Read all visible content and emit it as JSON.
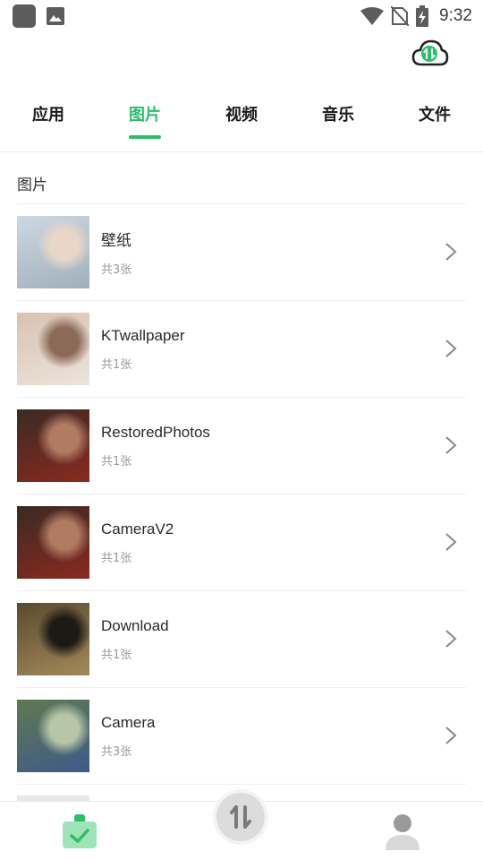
{
  "status_bar": {
    "time": "9:32"
  },
  "tabs": [
    {
      "label": "应用",
      "active": false
    },
    {
      "label": "图片",
      "active": true
    },
    {
      "label": "视频",
      "active": false
    },
    {
      "label": "音乐",
      "active": false
    },
    {
      "label": "文件",
      "active": false
    }
  ],
  "section_title": "图片",
  "albums": [
    {
      "name": "壁纸",
      "count": "共3张",
      "thumb_colors": [
        "#cdd8e2",
        "#e9d6c9",
        "#9fb0bb"
      ]
    },
    {
      "name": "KTwallpaper",
      "count": "共1张",
      "thumb_colors": [
        "#d8c2b1",
        "#8c6a58",
        "#ece4dc"
      ]
    },
    {
      "name": "RestoredPhotos",
      "count": "共1张",
      "thumb_colors": [
        "#3a2a24",
        "#b07a63",
        "#8a2a1e"
      ]
    },
    {
      "name": "CameraV2",
      "count": "共1张",
      "thumb_colors": [
        "#3a2a24",
        "#b07a63",
        "#8a2a1e"
      ]
    },
    {
      "name": "Download",
      "count": "共1张",
      "thumb_colors": [
        "#5a4a30",
        "#1d1a16",
        "#a48a5a"
      ]
    },
    {
      "name": "Camera",
      "count": "共3张",
      "thumb_colors": [
        "#5f7a4f",
        "#b8c6a8",
        "#3d5a8a"
      ]
    }
  ],
  "colors": {
    "accent": "#2dbe6a",
    "divider": "#efefef",
    "muted_text": "#999999"
  },
  "icons": {
    "status_left": [
      "notification-square-icon",
      "image-notification-icon"
    ],
    "status_right": [
      "wifi-icon",
      "no-sim-icon",
      "battery-charging-icon"
    ],
    "header": "cloud-transfer-icon",
    "row_action": "chevron-right-icon",
    "bottom_nav": [
      "home-bag-check-icon",
      "transfer-icon",
      "user-icon"
    ]
  }
}
